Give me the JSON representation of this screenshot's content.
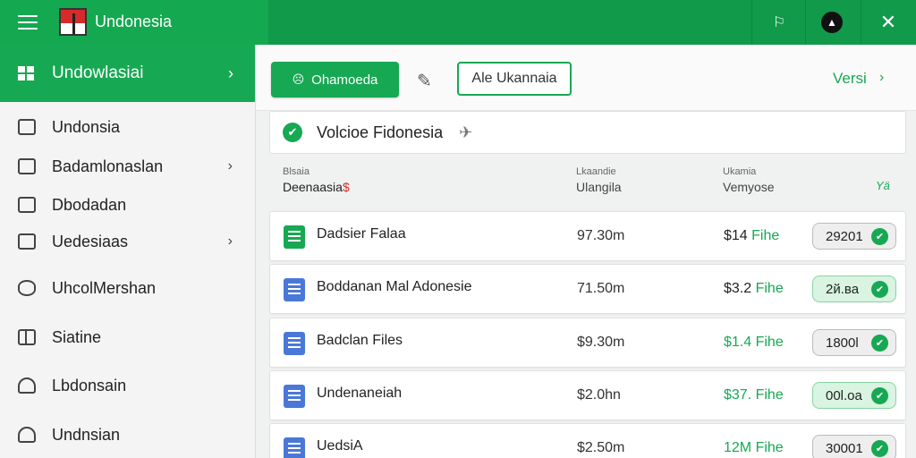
{
  "app": {
    "title": "Undonesia"
  },
  "topbar": {
    "flag_icon": "flag-icon",
    "avatar_icon": "user-avatar-icon",
    "close_icon": "close-icon"
  },
  "sidebar": {
    "header": {
      "label": "Undowlasiai",
      "icon": "grid-icon"
    },
    "items": [
      {
        "label": "Undonsia",
        "icon": "mail-icon",
        "has_chevron": false
      },
      {
        "label": "Badamlonaslan",
        "icon": "export-icon",
        "has_chevron": true
      },
      {
        "label": "Dbodadan",
        "icon": "envelope-icon",
        "has_chevron": false
      },
      {
        "label": "Uedesiaas",
        "icon": "camera-icon",
        "has_chevron": true
      },
      {
        "label": "UhcolMershan",
        "icon": "stack-icon",
        "has_chevron": false
      },
      {
        "label": "Siatine",
        "icon": "table-icon",
        "has_chevron": false
      },
      {
        "label": "Lbdonsain",
        "icon": "cloud-icon",
        "has_chevron": false
      },
      {
        "label": "Undnsian",
        "icon": "cloud-icon",
        "has_chevron": false
      }
    ]
  },
  "toolbar": {
    "primary_label": "Ohamoeda",
    "primary_prefix": "☹",
    "secondary_label": "Ale Ukannaia",
    "version_label": "Versi"
  },
  "title_card": {
    "label": "Volcioe Fidonesia"
  },
  "table": {
    "headers": {
      "col1_small": "Blsaia",
      "col1_main": "Deenaasia",
      "col1_mark": "$",
      "col2_small": "Lkaandie",
      "col2_main": "Ulangila",
      "col3_small": "Ukamia",
      "col3_main": "Vemyose",
      "col4": "Yä"
    },
    "rows": [
      {
        "name": "Dadsier Falaa",
        "icon": "sheet-icon",
        "icon_color": "green",
        "size": "97.30m",
        "price_amount": "$14",
        "price_unit": "Fihe",
        "price_green": false,
        "status": "29201",
        "status_active": false
      },
      {
        "name": "Boddanan Mal Adonesie",
        "icon": "doc-icon",
        "icon_color": "blue",
        "size": "71.50m",
        "price_amount": "$3.2",
        "price_unit": "Fihe",
        "price_green": false,
        "status": "2й.ва",
        "status_active": true
      },
      {
        "name": "Badclan Files",
        "icon": "doc-icon",
        "icon_color": "blue",
        "size": "$9.30m",
        "price_amount": "$1.4",
        "price_unit": "Fihe",
        "price_green": true,
        "status": "1800l",
        "status_active": false
      },
      {
        "name": "Undenaneiah",
        "icon": "doc-icon",
        "icon_color": "blue",
        "size": "$2.0hn",
        "price_amount": "$37.",
        "price_unit": "Fihe",
        "price_green": true,
        "status": "00l.oa",
        "status_active": true
      },
      {
        "name": "UedsiA",
        "icon": "doc-icon",
        "icon_color": "blue",
        "size": "$2.50m",
        "price_amount": "12M",
        "price_unit": "Fihe",
        "price_green": true,
        "status": "30001",
        "status_active": false
      }
    ]
  }
}
